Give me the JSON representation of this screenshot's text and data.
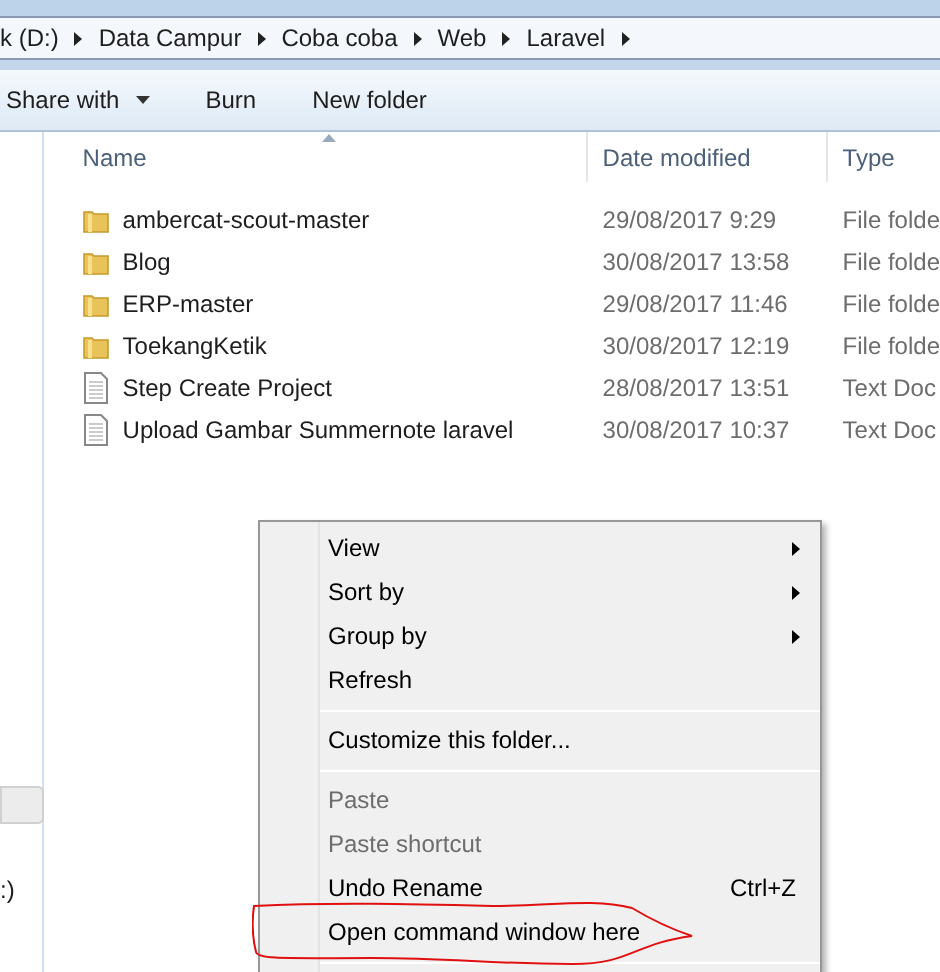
{
  "breadcrumb": [
    "k (D:)",
    "Data Campur",
    "Coba coba",
    "Web",
    "Laravel"
  ],
  "toolbar": [
    {
      "label": "Share with",
      "dropdown": true
    },
    {
      "label": "Burn",
      "dropdown": false
    },
    {
      "label": "New folder",
      "dropdown": false
    }
  ],
  "nav_pane": {
    "items": [
      {
        "selected": true
      },
      {
        "label": ":)",
        "selected": false
      }
    ]
  },
  "columns": [
    "Name",
    "Date modified",
    "Type"
  ],
  "files": [
    {
      "kind": "folder",
      "name": "ambercat-scout-master",
      "date": "29/08/2017 9:29",
      "type": "File folde"
    },
    {
      "kind": "folder",
      "name": "Blog",
      "date": "30/08/2017 13:58",
      "type": "File folde"
    },
    {
      "kind": "folder",
      "name": "ERP-master",
      "date": "29/08/2017 11:46",
      "type": "File folde"
    },
    {
      "kind": "folder",
      "name": "ToekangKetik",
      "date": "30/08/2017 12:19",
      "type": "File folde"
    },
    {
      "kind": "text",
      "name": "Step Create Project",
      "date": "28/08/2017 13:51",
      "type": "Text Doc"
    },
    {
      "kind": "text",
      "name": "Upload Gambar Summernote laravel",
      "date": "30/08/2017 10:37",
      "type": "Text Doc"
    }
  ],
  "context_menu": [
    {
      "kind": "item",
      "label": "View",
      "submenu": true,
      "disabled": false
    },
    {
      "kind": "item",
      "label": "Sort by",
      "submenu": true,
      "disabled": false
    },
    {
      "kind": "item",
      "label": "Group by",
      "submenu": true,
      "disabled": false
    },
    {
      "kind": "item",
      "label": "Refresh",
      "submenu": false,
      "disabled": false
    },
    {
      "kind": "separator"
    },
    {
      "kind": "item",
      "label": "Customize this folder...",
      "submenu": false,
      "disabled": false
    },
    {
      "kind": "separator"
    },
    {
      "kind": "item",
      "label": "Paste",
      "submenu": false,
      "disabled": true
    },
    {
      "kind": "item",
      "label": "Paste shortcut",
      "submenu": false,
      "disabled": true
    },
    {
      "kind": "item",
      "label": "Undo Rename",
      "shortcut": "Ctrl+Z",
      "submenu": false,
      "disabled": false
    },
    {
      "kind": "item",
      "label": "Open command window here",
      "submenu": false,
      "disabled": false
    },
    {
      "kind": "separator"
    }
  ]
}
